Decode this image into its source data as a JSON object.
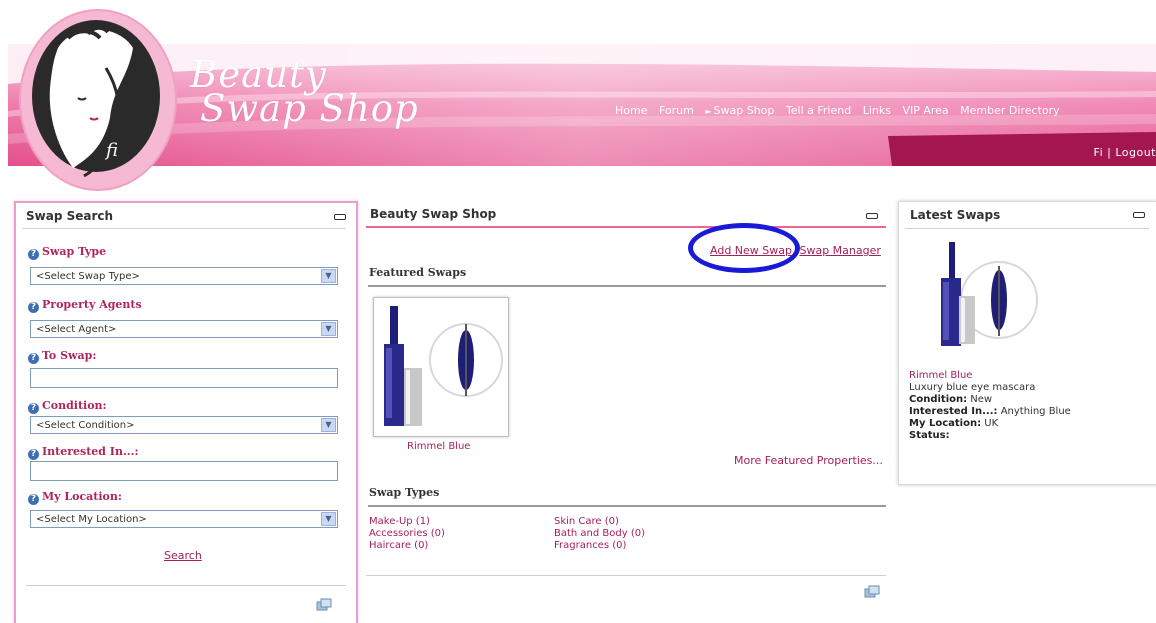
{
  "header": {
    "brand_line1": "Beauty",
    "brand_line2": "Swap Shop",
    "nav": [
      "Home",
      "Forum",
      "Swap Shop",
      "Tell a Friend",
      "Links",
      "VIP Area",
      "Member Directory"
    ],
    "user": "Fi | Logout",
    "logo_signature": "fi"
  },
  "search": {
    "title": "Swap Search",
    "swap_type_label": "Swap Type",
    "swap_type_value": "<Select Swap Type>",
    "agents_label": "Property Agents",
    "agents_value": "<Select Agent>",
    "to_swap_label": "To Swap:",
    "condition_label": "Condition:",
    "condition_value": "<Select Condition>",
    "interested_label": "Interested In...:",
    "location_label": "My Location:",
    "location_value": "<Select My Location>",
    "search_button": "Search"
  },
  "main": {
    "title": "Beauty Swap Shop",
    "add_new_swap": "Add New Swap",
    "swap_manager": "Swap Manager",
    "featured_title": "Featured Swaps",
    "featured_item": "Rimmel Blue",
    "more_featured": "More Featured Properties...",
    "swap_types_title": "Swap Types",
    "swap_types_col1": [
      "Make-Up (1)",
      "Accessories (0)",
      "Haircare (0)"
    ],
    "swap_types_col2": [
      "Skin Care (0)",
      "Bath and Body (0)",
      "Fragrances (0)"
    ]
  },
  "latest": {
    "title": "Latest Swaps",
    "item_name": "Rimmel Blue",
    "description": "Luxury blue eye mascara",
    "condition_label": "Condition:",
    "condition_value": " New",
    "interested_label": "Interested In...:",
    "interested_value": " Anything Blue",
    "location_label": "My Location:",
    "location_value": " UK",
    "status_label": "Status:"
  },
  "colors": {
    "banner_pink": "#ee6fa5",
    "banner_dark": "#a3164f",
    "link": "#a51f5c",
    "highlight": "#1a1ad6"
  }
}
